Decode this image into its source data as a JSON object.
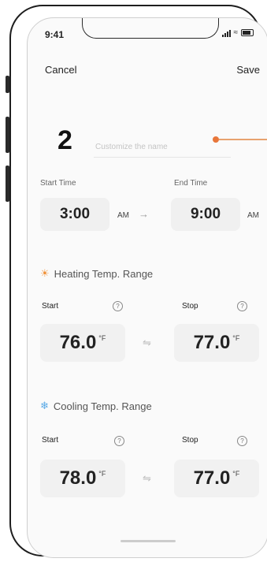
{
  "status": {
    "time": "9:41"
  },
  "nav": {
    "cancel": "Cancel",
    "save": "Save"
  },
  "slot": {
    "number": "2",
    "name_placeholder": "Customize the name"
  },
  "schedule": {
    "start_label": "Start Time",
    "end_label": "End Time",
    "start_time": "3:00",
    "start_ampm": "AM",
    "end_time": "9:00",
    "end_ampm": "AM",
    "arrow": "→"
  },
  "heating": {
    "title": "Heating Temp. Range",
    "start_label": "Start",
    "stop_label": "Stop",
    "start_value": "76.0",
    "stop_value": "77.0",
    "unit": "°F"
  },
  "cooling": {
    "title": "Cooling Temp. Range",
    "start_label": "Start",
    "stop_label": "Stop",
    "start_value": "78.0",
    "stop_value": "77.0",
    "unit": "°F"
  },
  "icons": {
    "help": "?",
    "swap": "⇋",
    "heat": "sun-icon",
    "cool": "snowflake-icon"
  },
  "colors": {
    "accent_orange": "#e8763a",
    "heat_icon": "#f0923a",
    "cool_icon": "#5aa9e6"
  }
}
